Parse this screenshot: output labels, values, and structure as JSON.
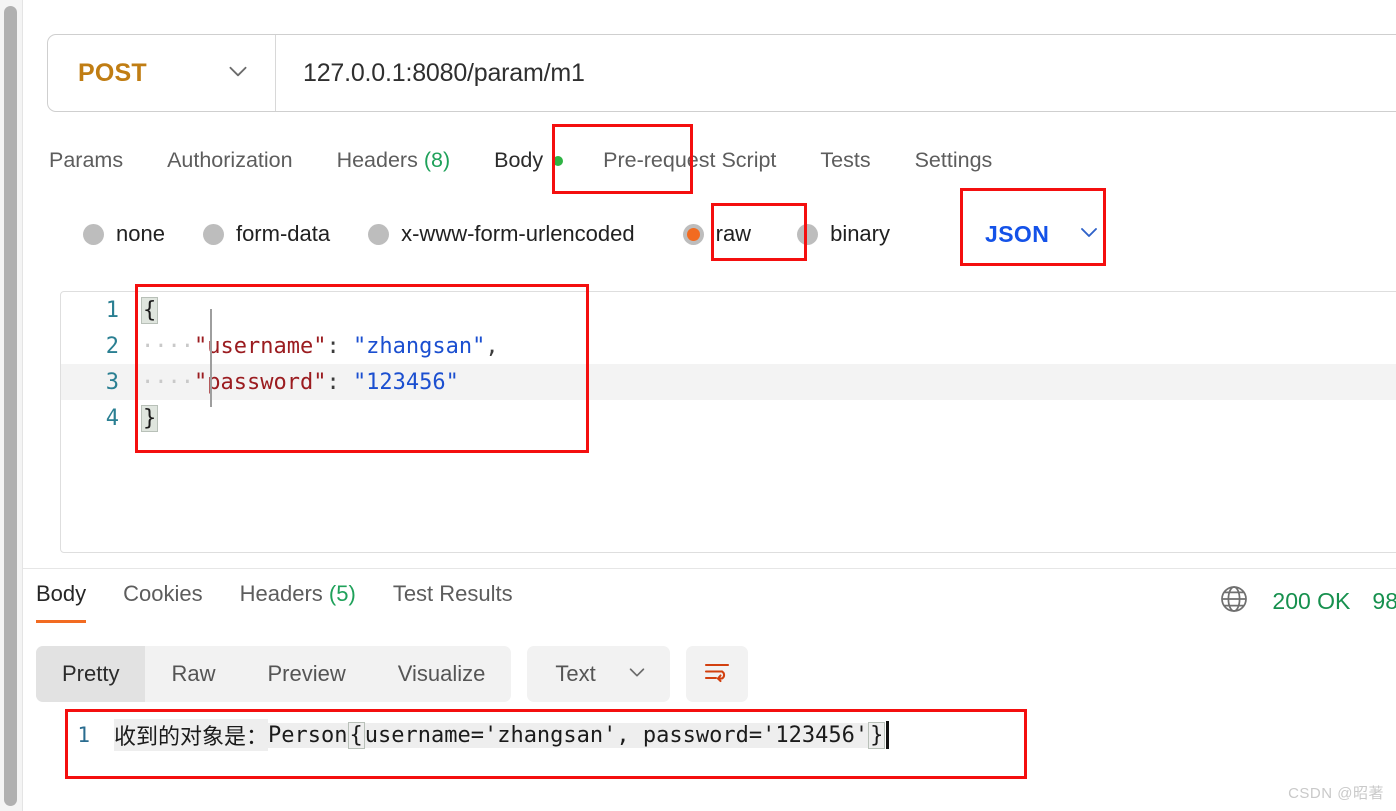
{
  "request": {
    "method": "POST",
    "url": "127.0.0.1:8080/param/m1",
    "tabs": [
      {
        "label": "Params",
        "count": "",
        "active": false
      },
      {
        "label": "Authorization",
        "count": "",
        "active": false
      },
      {
        "label": "Headers",
        "count": "(8)",
        "active": false
      },
      {
        "label": "Body",
        "count": "",
        "active": true
      },
      {
        "label": "Pre-request Script",
        "count": "",
        "active": false
      },
      {
        "label": "Tests",
        "count": "",
        "active": false
      },
      {
        "label": "Settings",
        "count": "",
        "active": false
      }
    ],
    "body_types": [
      {
        "label": "none",
        "checked": false
      },
      {
        "label": "form-data",
        "checked": false
      },
      {
        "label": "x-www-form-urlencoded",
        "checked": false
      },
      {
        "label": "raw",
        "checked": true
      },
      {
        "label": "binary",
        "checked": false
      }
    ],
    "raw_format": "JSON",
    "editor": {
      "lines": [
        {
          "no": "1",
          "brace_open": "{",
          "indent": "",
          "key": "",
          "colon": "",
          "value": "",
          "comma": ""
        },
        {
          "no": "2",
          "brace_open": "",
          "indent": "····",
          "key": "\"username\"",
          "colon": ":",
          "value": "\"zhangsan\"",
          "comma": ","
        },
        {
          "no": "3",
          "brace_open": "",
          "indent": "····",
          "key": "\"password\"",
          "colon": ":",
          "value": "\"123456\"",
          "comma": ""
        },
        {
          "no": "4",
          "brace_open": "}",
          "indent": "",
          "key": "",
          "colon": "",
          "value": "",
          "comma": ""
        }
      ]
    }
  },
  "response": {
    "tabs": [
      {
        "label": "Body",
        "count": "",
        "active": true
      },
      {
        "label": "Cookies",
        "count": "",
        "active": false
      },
      {
        "label": "Headers",
        "count": "(5)",
        "active": false
      },
      {
        "label": "Test Results",
        "count": "",
        "active": false
      }
    ],
    "status": "200 OK",
    "size": "98",
    "viewer_modes": [
      {
        "label": "Pretty",
        "active": true
      },
      {
        "label": "Raw",
        "active": false
      },
      {
        "label": "Preview",
        "active": false
      },
      {
        "label": "Visualize",
        "active": false
      }
    ],
    "format": "Text",
    "body": {
      "line_number": "1",
      "prefix_cn": "收到的对象是：",
      "class_name": "Person",
      "brace_open": "{",
      "fields": "username='zhangsan', password='123456'",
      "brace_close": "}"
    }
  },
  "watermark": "CSDN @昭著",
  "colors": {
    "accent_orange": "#f26b21",
    "annotation_red": "#f40f0f",
    "status_green": "#16904e",
    "method_gold": "#c07d13",
    "json_blue": "#1452e8"
  }
}
